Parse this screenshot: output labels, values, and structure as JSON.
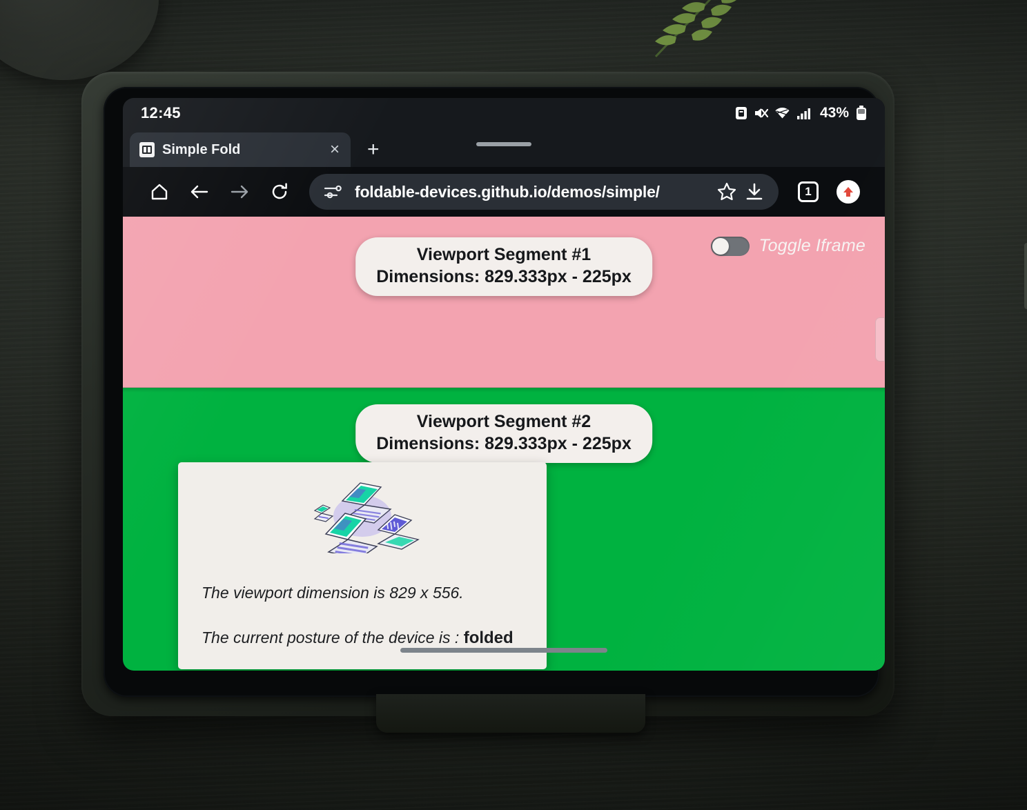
{
  "status_bar": {
    "clock": "12:45",
    "battery_percent": "43%",
    "icons": [
      "screen-record-icon",
      "mute-icon",
      "wifi-icon",
      "signal-icon",
      "battery-icon"
    ]
  },
  "browser": {
    "tab": {
      "title": "Simple Fold",
      "favicon": "fold-favicon",
      "close_label": "×"
    },
    "new_tab_label": "+",
    "toolbar": {
      "home_icon": "home-icon",
      "back_icon": "back-arrow-icon",
      "forward_icon": "forward-arrow-icon",
      "reload_icon": "reload-icon",
      "site_settings_icon": "tune-icon",
      "url": "foldable-devices.github.io/demos/simple/",
      "bookmark_icon": "star-icon",
      "download_icon": "download-icon",
      "tab_count": "1",
      "menu_icon": "update-avatar-icon"
    }
  },
  "page": {
    "toggle": {
      "label": "Toggle Iframe",
      "state": "off"
    },
    "segments": [
      {
        "title": "Viewport Segment #1",
        "dimensions": "Dimensions: 829.333px - 225px",
        "color": "#f3a3b0"
      },
      {
        "title": "Viewport Segment #2",
        "dimensions": "Dimensions: 829.333px - 225px",
        "color": "#00b240"
      }
    ],
    "card": {
      "illustration": "foldable-devices-illustration",
      "viewport_line": "The viewport dimension is 829 x 556.",
      "posture_prefix": "The current posture of the device is : ",
      "posture_value": "folded"
    }
  },
  "colors": {
    "segment1": "#f3a3b0",
    "segment2": "#00b240",
    "chrome_dark": "#0b0d10",
    "tab_bg": "#2a2f36",
    "card_bg": "#f1eeea"
  }
}
